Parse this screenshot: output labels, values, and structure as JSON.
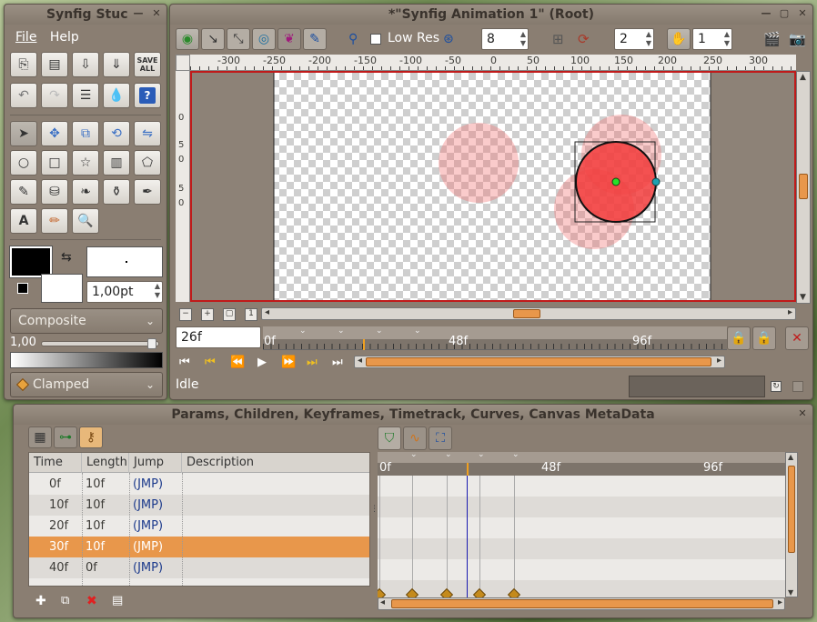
{
  "toolbox": {
    "title": "Synfig Stuc",
    "menu": {
      "file": "File",
      "help": "Help"
    },
    "save_all": "SAVE ALL",
    "width_value": "1,00pt",
    "blend": "Composite",
    "amount": "1,00",
    "interp": "Clamped"
  },
  "canvas_window": {
    "title": "*\"Synfig Animation 1\" (Root)",
    "low_res_label": "Low Res",
    "quality": "8",
    "onion_past": "2",
    "onion_future": "1",
    "ruler_labels": [
      "-300",
      "-250",
      "-200",
      "-150",
      "-100",
      "-50",
      "0",
      "50",
      "100",
      "150",
      "200",
      "250",
      "300"
    ],
    "vruler_labels": [
      "0",
      "5",
      "0",
      "5",
      "0"
    ],
    "current_frame": "26f",
    "timebar_labels": [
      "0f",
      "48f",
      "96f"
    ],
    "status": "Idle"
  },
  "params_panel": {
    "title": "Params, Children, Keyframes, Timetrack, Curves, Canvas MetaData",
    "columns": [
      "Time",
      "Length",
      "Jump",
      "Description"
    ],
    "rows": [
      {
        "time": "0f",
        "length": "10f",
        "jump": "(JMP)",
        "description": ""
      },
      {
        "time": "10f",
        "length": "10f",
        "jump": "(JMP)",
        "description": ""
      },
      {
        "time": "20f",
        "length": "10f",
        "jump": "(JMP)",
        "description": ""
      },
      {
        "time": "30f",
        "length": "10f",
        "jump": "(JMP)",
        "description": ""
      },
      {
        "time": "40f",
        "length": "0f",
        "jump": "(JMP)",
        "description": ""
      }
    ],
    "selected_row": 3,
    "timetrack_labels": [
      "0f",
      "48f",
      "96f"
    ]
  },
  "colors": {
    "accent": "#e8974b",
    "window": "#8a7e72",
    "red_circle": "#f23c3c"
  }
}
